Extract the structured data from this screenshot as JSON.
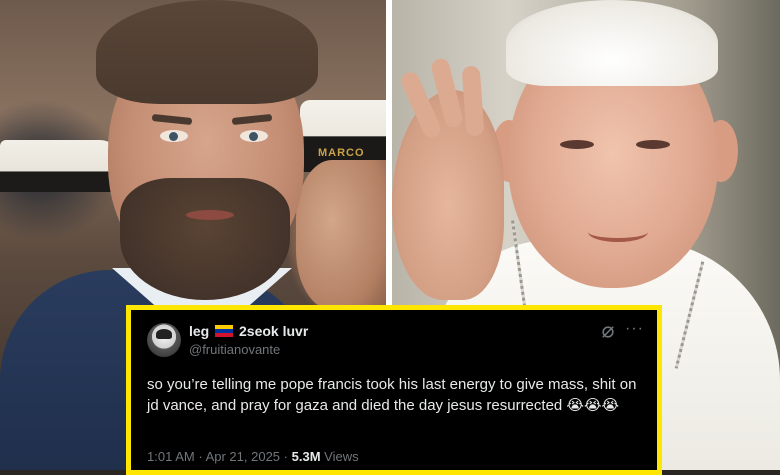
{
  "tweet": {
    "display_name_a": "leg",
    "flag_emoji": "🇻🇪",
    "display_name_b": "2seok luvr",
    "handle": "@fruitianovante",
    "text": "so you’re telling me pope francis took his last energy to give mass, shit on jd vance, and pray for gaza and died the day jesus resurrected 😭😭😭",
    "time": "1:01 AM",
    "separator": "·",
    "date": "Apr 21, 2025",
    "views_count": "5.3M",
    "views_label": "Views",
    "more_label": "···"
  },
  "photos": {
    "left_cap_text": "MARCO"
  },
  "colors": {
    "card_border": "#ffe600",
    "card_bg": "#000000",
    "text": "#e7e9ea",
    "muted": "#71767b"
  },
  "icons": {
    "grok": "grok-icon",
    "more": "more-icon"
  }
}
